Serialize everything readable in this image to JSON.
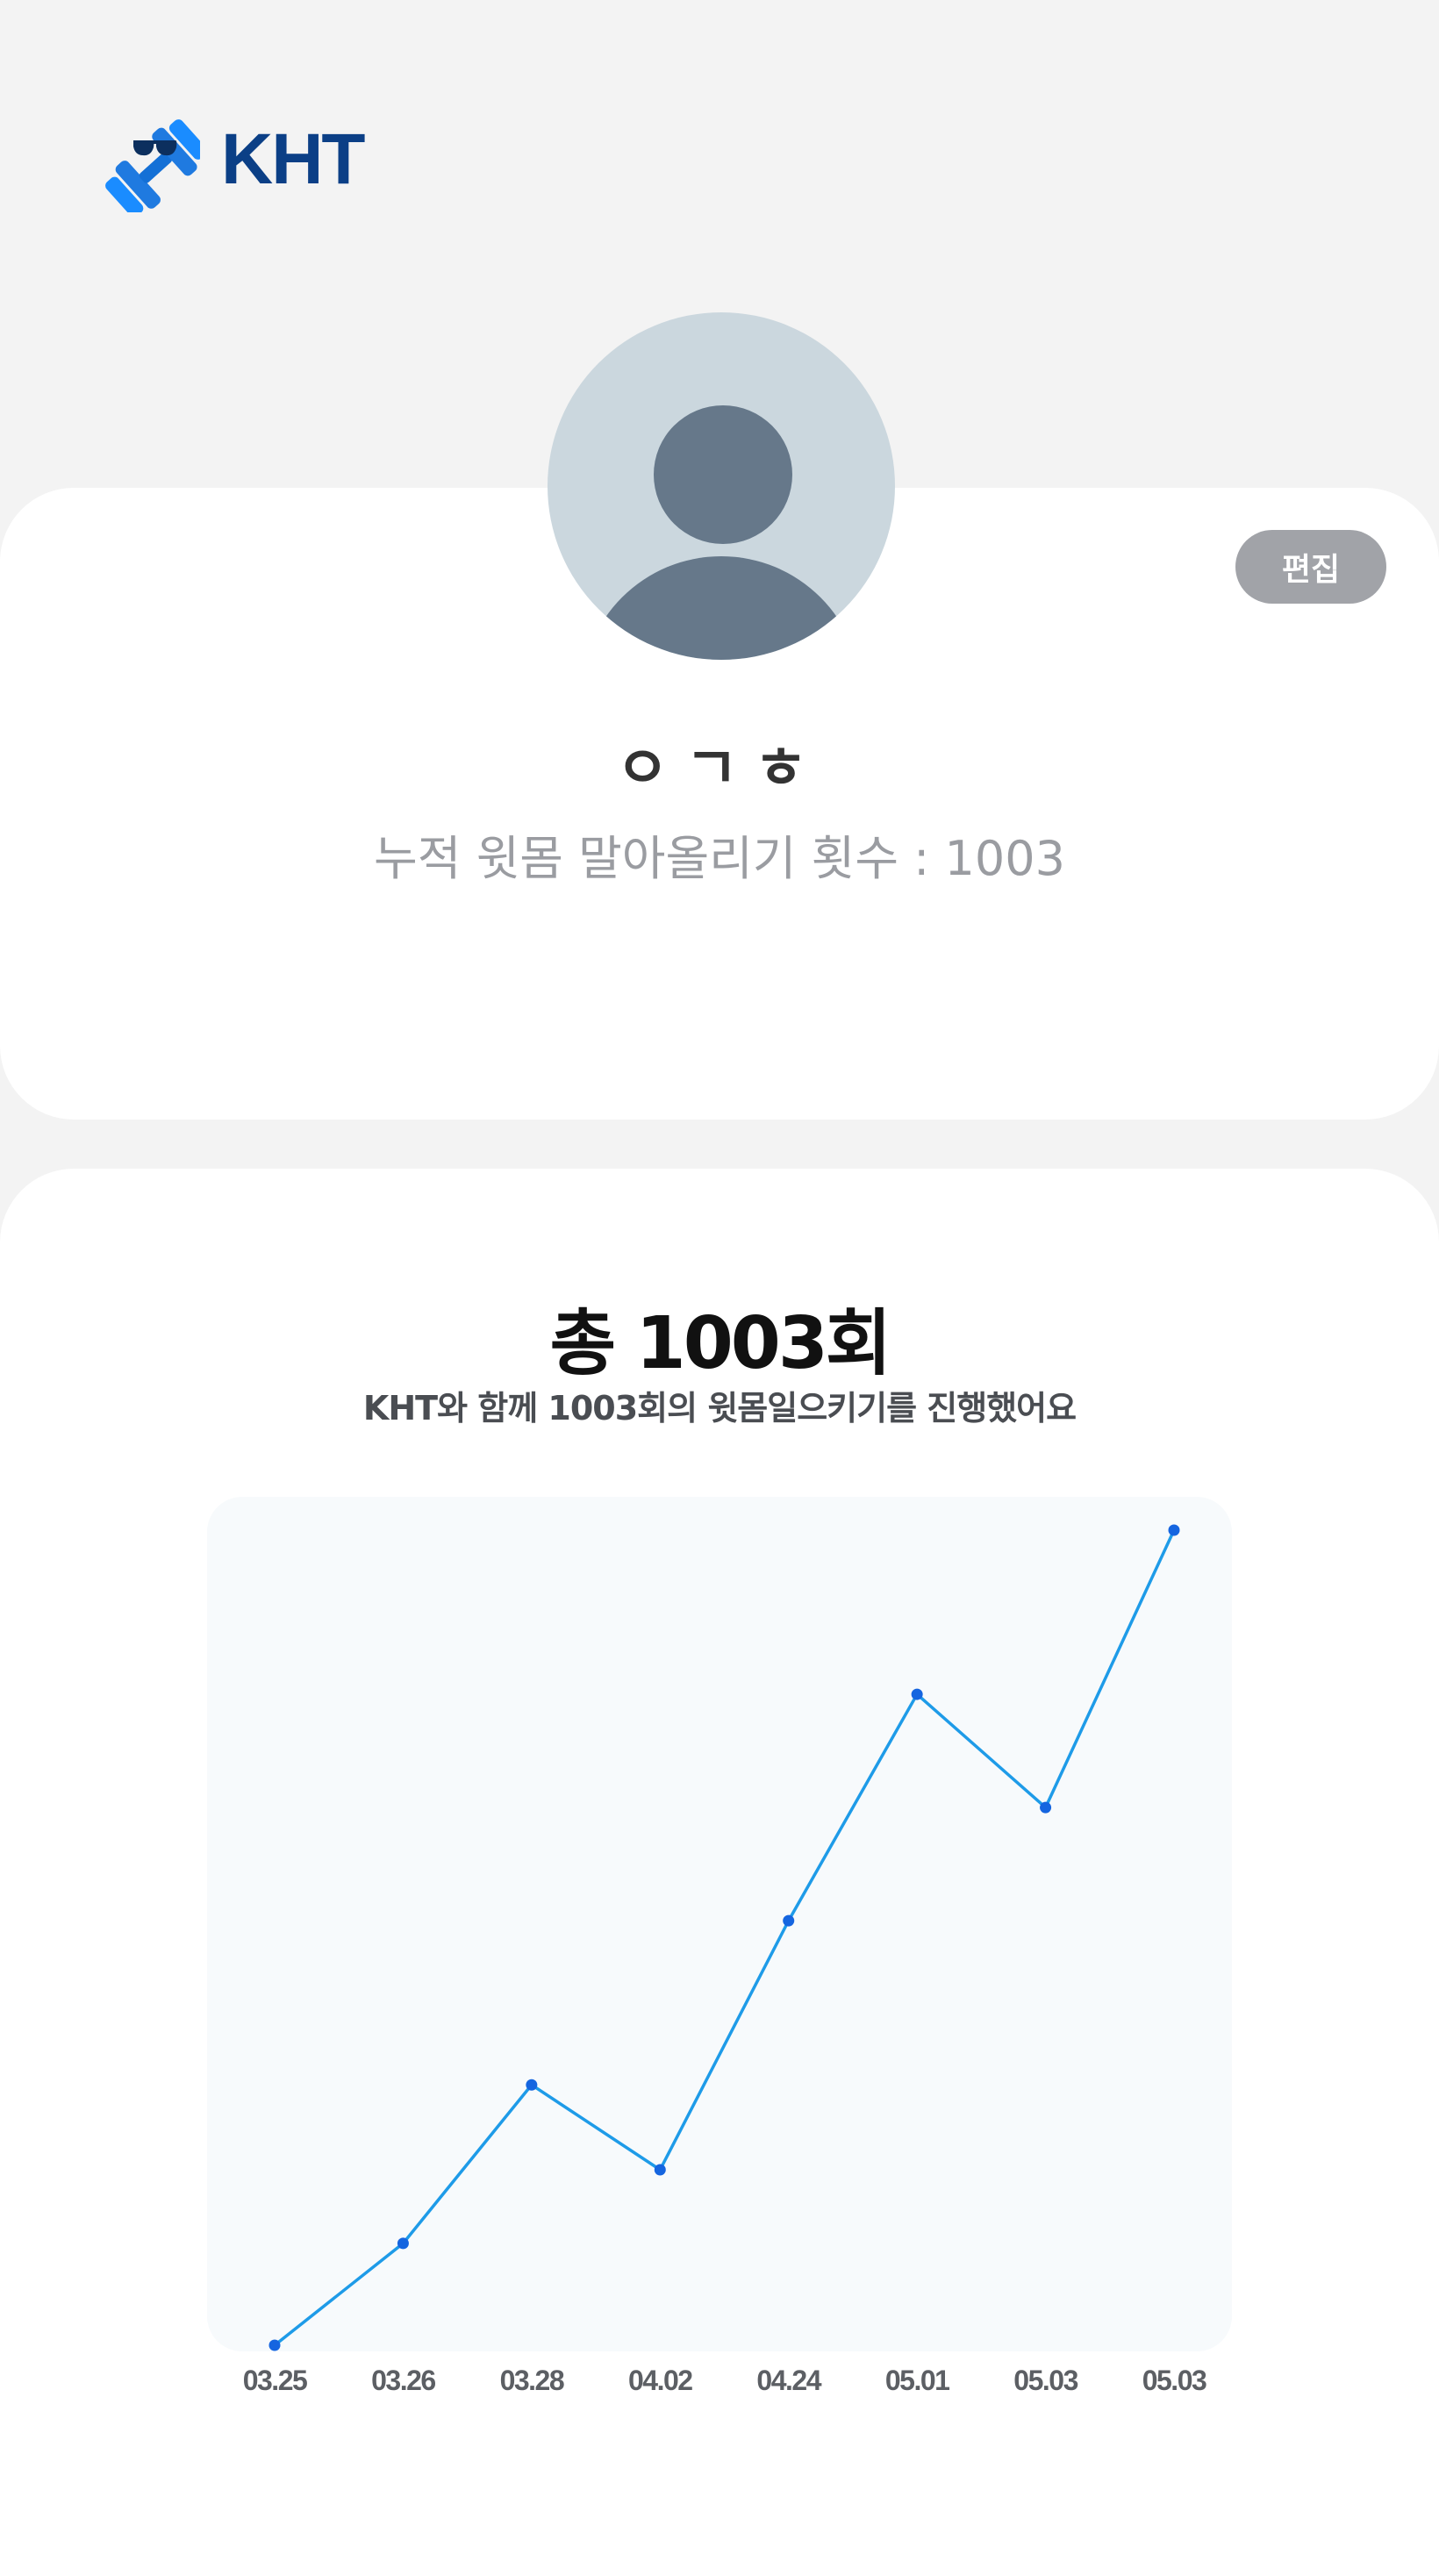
{
  "brand": {
    "name": "KHT",
    "color": "#0b3f86",
    "logo_icon": "dumbbell-sunglasses-icon"
  },
  "profile": {
    "name": "ㅇㄱㅎ",
    "cumulative_label": "누적 윗몸 말아올리기 횟수",
    "cumulative_value": "1003",
    "cumulative_text": "누적 윗몸 말아올리기 횟수 : 1003",
    "edit_label": "편집",
    "avatar_icon": "user-avatar-icon"
  },
  "summary": {
    "title": "총 1003회",
    "subtitle": "KHT와 함께 1003회의 윗몸일으키기를 진행했어요"
  },
  "chart_data": {
    "type": "line",
    "title": "",
    "xlabel": "",
    "ylabel": "",
    "categories": [
      "03.25",
      "03.26",
      "03.28",
      "04.02",
      "04.24",
      "05.01",
      "05.03",
      "05.03"
    ],
    "series": [
      {
        "values": [
          0,
          18,
          46,
          31,
          75,
          115,
          95,
          144
        ],
        "color": "#1e9be8"
      }
    ],
    "ylim": [
      0,
      155
    ],
    "grid": false,
    "legend": "none",
    "point_color": "#1565e0",
    "background": "#f7fafc"
  }
}
